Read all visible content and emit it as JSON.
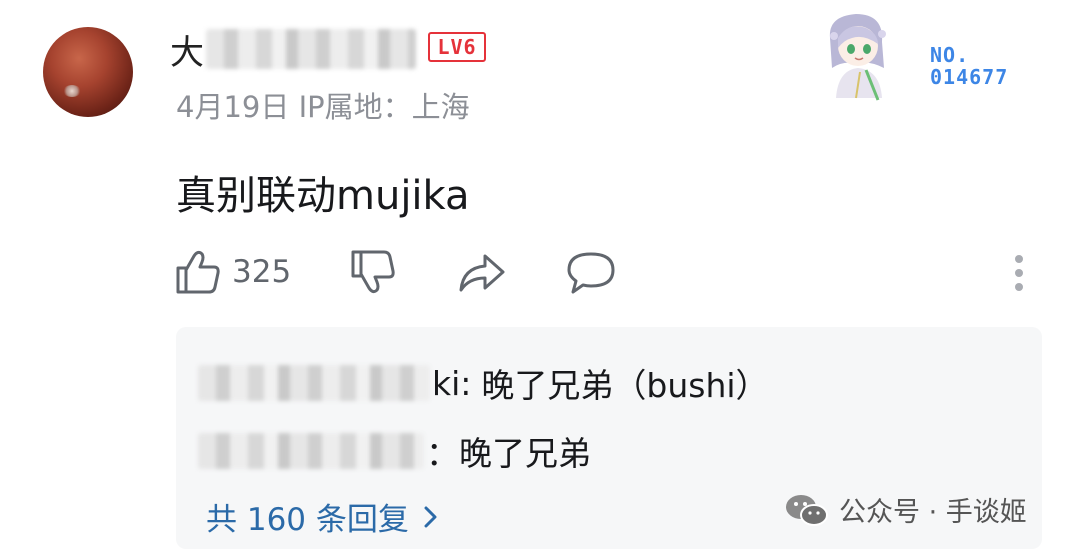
{
  "comment": {
    "username_visible": "大",
    "level_badge": "LV6",
    "meta": "4月19日 IP属地：上海",
    "text": "真别联动mujika",
    "like_count": "325"
  },
  "decoration": {
    "number_line1": "NO.",
    "number_line2": "014677"
  },
  "replies": [
    {
      "author_suffix": "ki:",
      "text": "晚了兄弟（bushi）"
    },
    {
      "author_suffix": "：",
      "text": "晚了兄弟"
    }
  ],
  "more_replies": "共 160 条回复",
  "watermark": "公众号 · 手谈姬",
  "colors": {
    "level_red": "#e5323a",
    "link_blue": "#2b6aa8",
    "deco_blue": "#3d86e6",
    "muted_gray": "#8c8f96"
  }
}
